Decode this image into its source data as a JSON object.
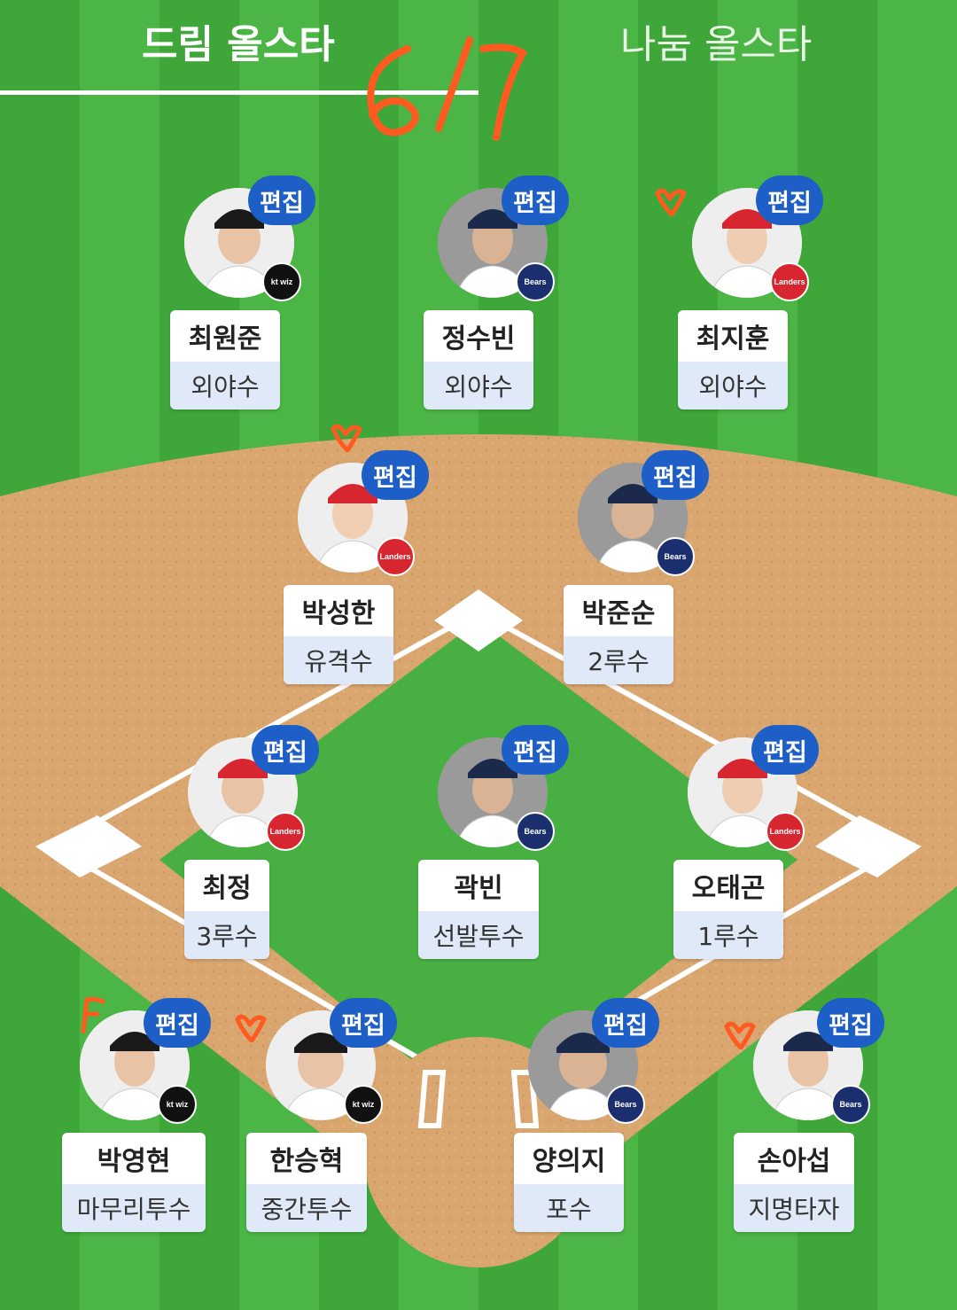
{
  "tabs": {
    "dream": "드림 올스타",
    "nanum": "나눔 올스타"
  },
  "handwriting": "6/7",
  "edit_label": "편집",
  "players": [
    {
      "id": "lf",
      "name": "최원준",
      "position": "외야수",
      "team": "kt wiz",
      "mark": ""
    },
    {
      "id": "cf",
      "name": "정수빈",
      "position": "외야수",
      "team": "Bears",
      "mark": ""
    },
    {
      "id": "rf",
      "name": "최지훈",
      "position": "외야수",
      "team": "Landers",
      "mark": "heart"
    },
    {
      "id": "ss",
      "name": "박성한",
      "position": "유격수",
      "team": "Landers",
      "mark": "heart"
    },
    {
      "id": "2b",
      "name": "박준순",
      "position": "2루수",
      "team": "Bears",
      "mark": ""
    },
    {
      "id": "3b",
      "name": "최정",
      "position": "3루수",
      "team": "Landers",
      "mark": ""
    },
    {
      "id": "sp",
      "name": "곽빈",
      "position": "선발투수",
      "team": "Bears",
      "mark": ""
    },
    {
      "id": "1b",
      "name": "오태곤",
      "position": "1루수",
      "team": "Landers",
      "mark": ""
    },
    {
      "id": "cl",
      "name": "박영현",
      "position": "마무리투수",
      "team": "kt wiz",
      "mark": "F"
    },
    {
      "id": "rp",
      "name": "한승혁",
      "position": "중간투수",
      "team": "kt wiz",
      "mark": "heart"
    },
    {
      "id": "c",
      "name": "양의지",
      "position": "포수",
      "team": "Bears",
      "mark": ""
    },
    {
      "id": "dh",
      "name": "손아섭",
      "position": "지명타자",
      "team": "Bears",
      "mark": "heart"
    }
  ],
  "colors": {
    "edit_button": "#1d5fc6",
    "position_bg": "#dfe9f7",
    "dirt": "#d9a66f",
    "grass": "#45ad3f",
    "annotation": "#ff5a1f"
  }
}
